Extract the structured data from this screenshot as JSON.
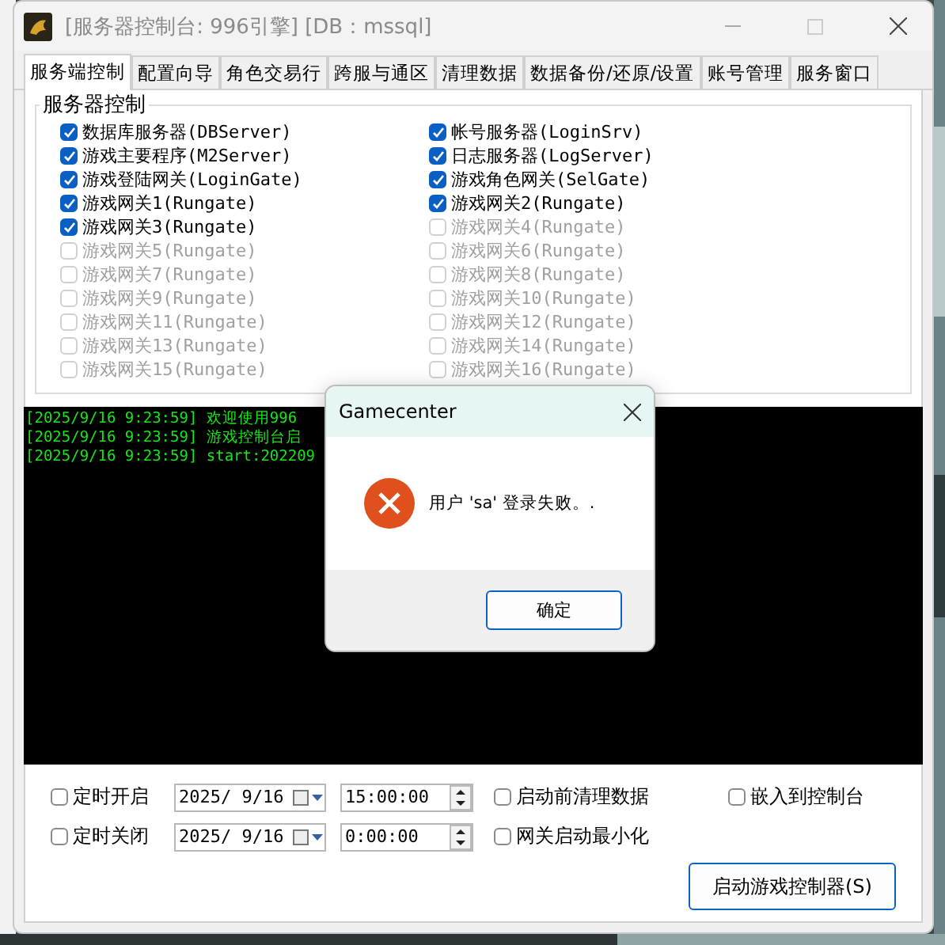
{
  "window": {
    "title": "[服务器控制台: 996引擎] [DB：mssql]"
  },
  "tabs": [
    {
      "label": "服务端控制",
      "selected": true
    },
    {
      "label": "配置向导",
      "selected": false
    },
    {
      "label": "角色交易行",
      "selected": false
    },
    {
      "label": "跨服与通区",
      "selected": false
    },
    {
      "label": "清理数据",
      "selected": false
    },
    {
      "label": "数据备份/还原/设置",
      "selected": false
    },
    {
      "label": "账号管理",
      "selected": false
    },
    {
      "label": "服务窗口",
      "selected": false
    }
  ],
  "server_group": {
    "title": "服务器控制",
    "services": [
      {
        "label": "数据库服务器(DBServer)",
        "checked": true,
        "disabled": false
      },
      {
        "label": "帐号服务器(LoginSrv)",
        "checked": true,
        "disabled": false
      },
      {
        "label": "游戏主要程序(M2Server)",
        "checked": true,
        "disabled": false
      },
      {
        "label": "日志服务器(LogServer)",
        "checked": true,
        "disabled": false
      },
      {
        "label": "游戏登陆网关(LoginGate)",
        "checked": true,
        "disabled": false
      },
      {
        "label": "游戏角色网关(SelGate)",
        "checked": true,
        "disabled": false
      },
      {
        "label": "游戏网关1(Rungate)",
        "checked": true,
        "disabled": false
      },
      {
        "label": "游戏网关2(Rungate)",
        "checked": true,
        "disabled": false
      },
      {
        "label": "游戏网关3(Rungate)",
        "checked": true,
        "disabled": false
      },
      {
        "label": "游戏网关4(Rungate)",
        "checked": false,
        "disabled": true
      },
      {
        "label": "游戏网关5(Rungate)",
        "checked": false,
        "disabled": true
      },
      {
        "label": "游戏网关6(Rungate)",
        "checked": false,
        "disabled": true
      },
      {
        "label": "游戏网关7(Rungate)",
        "checked": false,
        "disabled": true
      },
      {
        "label": "游戏网关8(Rungate)",
        "checked": false,
        "disabled": true
      },
      {
        "label": "游戏网关9(Rungate)",
        "checked": false,
        "disabled": true
      },
      {
        "label": "游戏网关10(Rungate)",
        "checked": false,
        "disabled": true
      },
      {
        "label": "游戏网关11(Rungate)",
        "checked": false,
        "disabled": true
      },
      {
        "label": "游戏网关12(Rungate)",
        "checked": false,
        "disabled": true
      },
      {
        "label": "游戏网关13(Rungate)",
        "checked": false,
        "disabled": true
      },
      {
        "label": "游戏网关14(Rungate)",
        "checked": false,
        "disabled": true
      },
      {
        "label": "游戏网关15(Rungate)",
        "checked": false,
        "disabled": true
      },
      {
        "label": "游戏网关16(Rungate)",
        "checked": false,
        "disabled": true
      }
    ]
  },
  "log": {
    "lines": [
      "[2025/9/16 9:23:59] 欢迎使用996",
      "[2025/9/16 9:23:59] 游戏控制台启",
      "[2025/9/16 9:23:59] start:202209"
    ]
  },
  "schedule": [
    {
      "label": "定时开启",
      "checked": false,
      "date": "2025/ 9/16",
      "time": "15:00:00"
    },
    {
      "label": "定时关闭",
      "checked": false,
      "date": "2025/ 9/16",
      "time": "0:00:00"
    }
  ],
  "options": [
    {
      "label": "启动前清理数据",
      "checked": false
    },
    {
      "label": "嵌入到控制台",
      "checked": false
    },
    {
      "label": "网关启动最小化",
      "checked": false
    }
  ],
  "start_button": "启动游戏控制器(S)",
  "dialog": {
    "title": "Gamecenter",
    "message": "用户 'sa' 登录失败。.",
    "button": "确定"
  }
}
